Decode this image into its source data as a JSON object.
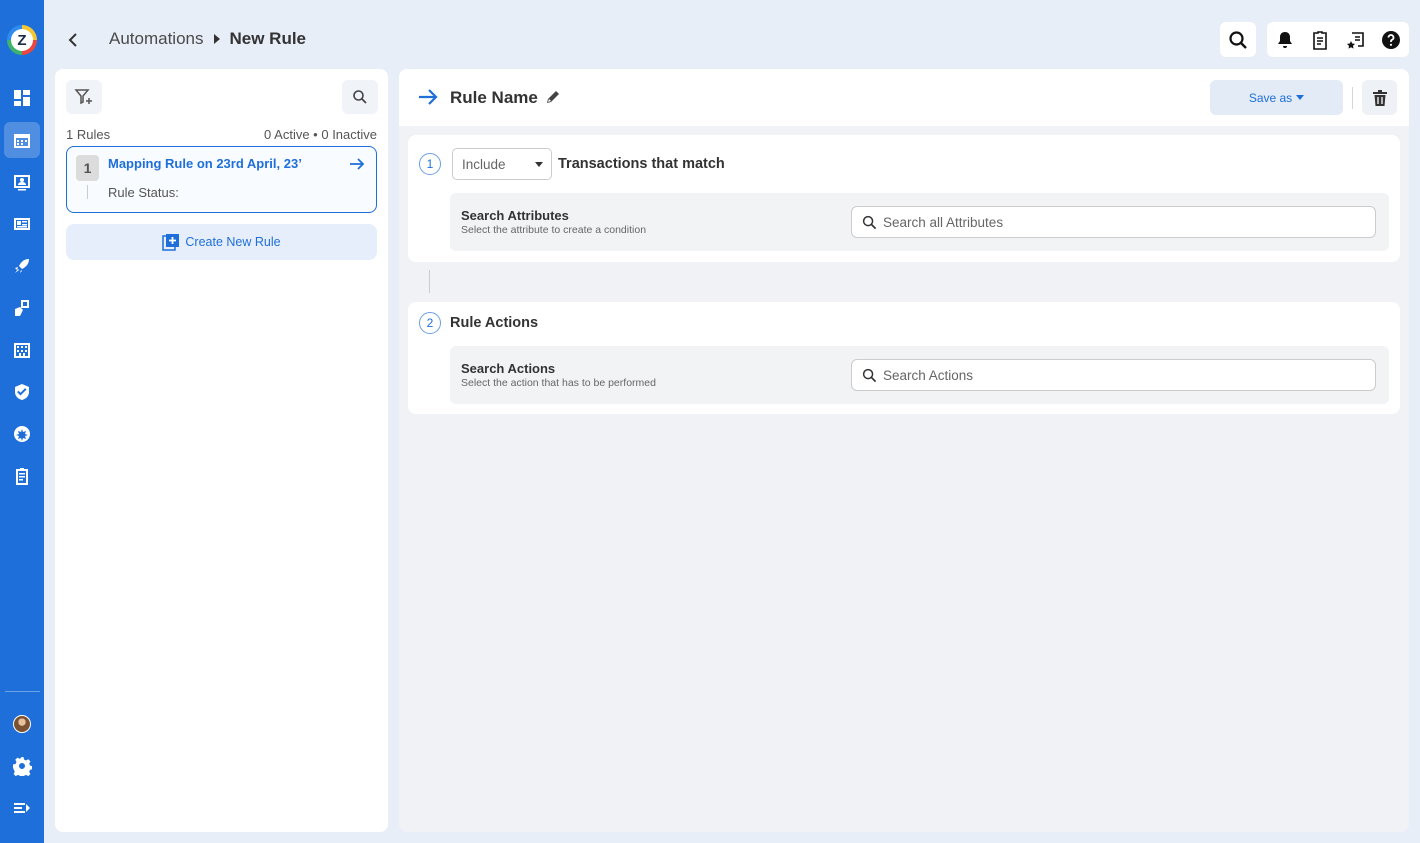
{
  "header": {
    "breadcrumb_parent": "Automations",
    "breadcrumb_current": "New Rule"
  },
  "rules_panel": {
    "rules_count": "1 Rules",
    "status_summary": "0 Active • 0 Inactive",
    "rules": [
      {
        "number": "1",
        "title": "Mapping Rule on 23rd April, 23’",
        "status_label": "Rule Status:"
      }
    ],
    "create_label": "Create New Rule"
  },
  "editor": {
    "rule_name": "Rule Name",
    "save_label": "Save as",
    "conditions": {
      "step": "1",
      "include_value": "Include",
      "title": "Transactions that match",
      "search_title": "Search Attributes",
      "search_subtitle": "Select the attribute to create a condition",
      "search_placeholder": "Search all Attributes"
    },
    "actions": {
      "step": "2",
      "title": "Rule Actions",
      "search_title": "Search Actions",
      "search_subtitle": "Select the action that has to be performed",
      "search_placeholder": "Search Actions"
    }
  },
  "colors": {
    "brand": "#1e6fd9",
    "background": "#e8eef8"
  },
  "icons": [
    "logo-icon",
    "dashboard-icon",
    "calendar-icon",
    "contacts-icon",
    "news-icon",
    "rocket-icon",
    "reports-icon",
    "building-icon",
    "shield-icon",
    "globe-icon",
    "clipboard-icon",
    "settings-icon",
    "menu-collapse-icon",
    "search-icon",
    "bell-icon",
    "notes-icon",
    "starred-list-icon",
    "help-icon",
    "filter-add-icon",
    "arrow-right-icon",
    "pencil-icon",
    "trash-icon",
    "add-box-icon"
  ]
}
